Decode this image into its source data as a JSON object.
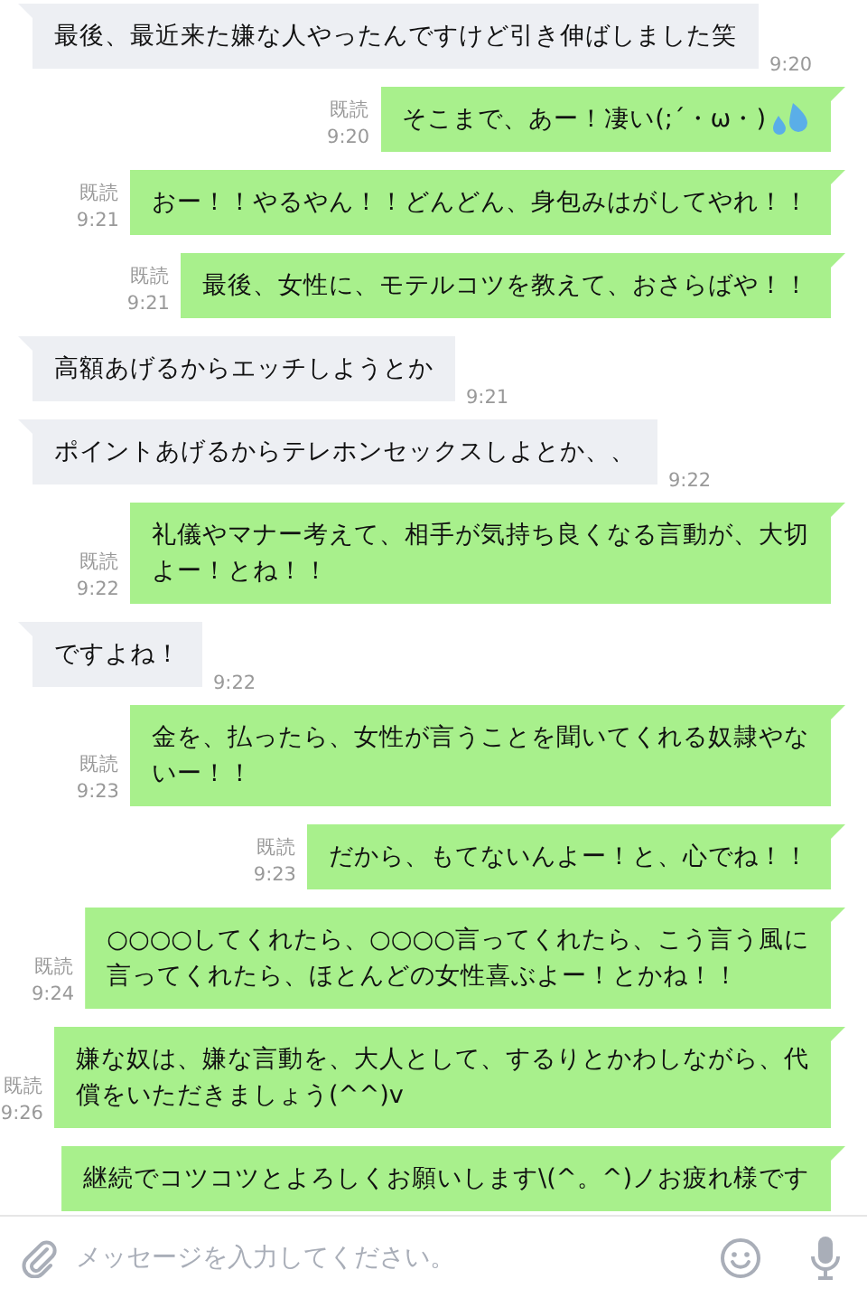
{
  "messages": [
    {
      "kind": "received",
      "lines": [
        "最後、最近来た嫌な人やったんですけど引き伸ばしました笑"
      ],
      "time": "9:20"
    },
    {
      "kind": "sent",
      "lines": [
        "そこまで、あー！凄い(;´・ω・)"
      ],
      "sweat": true,
      "read": "既読",
      "time": "9:20"
    },
    {
      "kind": "sent",
      "lines": [
        "おー！！やるやん！！どんどん、身包みはがしてやれ！！"
      ],
      "read": "既読",
      "time": "9:21"
    },
    {
      "kind": "sent",
      "lines": [
        "最後、女性に、モテルコツを教えて、おさらばや！！"
      ],
      "read": "既読",
      "time": "9:21"
    },
    {
      "kind": "received",
      "lines": [
        "高額あげるからエッチしようとか"
      ],
      "time": "9:21"
    },
    {
      "kind": "received",
      "lines": [
        "ポイントあげるからテレホンセックスしよとか、、"
      ],
      "time": "9:22"
    },
    {
      "kind": "sent",
      "lines": [
        "礼儀やマナー考えて、相手が気持ち良くなる言動が、大切",
        "よー！とね！！"
      ],
      "read": "既読",
      "time": "9:22"
    },
    {
      "kind": "received",
      "lines": [
        "ですよね！"
      ],
      "time": "9:22"
    },
    {
      "kind": "sent",
      "lines": [
        "金を、払ったら、女性が言うことを聞いてくれる奴隷やな",
        "いー！！"
      ],
      "read": "既読",
      "time": "9:23"
    },
    {
      "kind": "sent",
      "lines": [
        "だから、もてないんよー！と、心でね！！"
      ],
      "read": "既読",
      "time": "9:23"
    },
    {
      "kind": "sent",
      "lines": [
        "○○○○してくれたら、○○○○言ってくれたら、こう言う風に",
        "言ってくれたら、ほとんどの女性喜ぶよー！とかね！！"
      ],
      "read": "既読",
      "time": "9:24"
    },
    {
      "kind": "sent",
      "lines": [
        "嫌な奴は、嫌な言動を、大人として、するりとかわしながら、代",
        "償をいただきましょう(^^)v"
      ],
      "read": "既読",
      "time": "9:26"
    },
    {
      "kind": "sent",
      "lines": [
        "継続でコツコツとよろしくお願いします\\(^。^)ノお疲れ様です"
      ]
    }
  ],
  "input": {
    "placeholder": "メッセージを入力してください。"
  }
}
